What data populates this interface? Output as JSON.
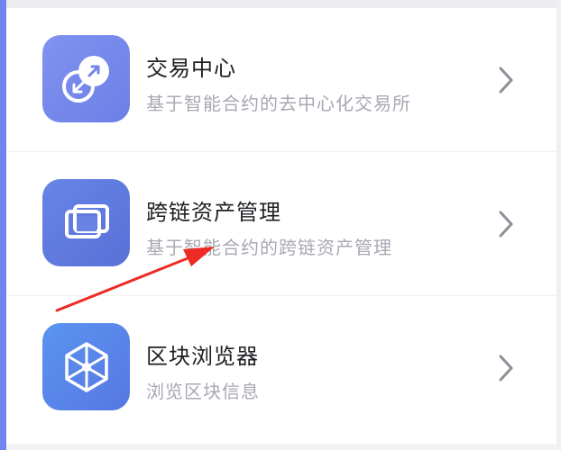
{
  "list": {
    "items": [
      {
        "title": "交易中心",
        "subtitle": "基于智能合约的去中心化交易所",
        "icon": "exchange-icon"
      },
      {
        "title": "跨链资产管理",
        "subtitle": "基于智能合约的跨链资产管理",
        "icon": "cross-chain-icon"
      },
      {
        "title": "区块浏览器",
        "subtitle": "浏览区块信息",
        "icon": "block-explorer-icon"
      }
    ]
  },
  "colors": {
    "accent": "#6f86ee",
    "title": "#1f1f24",
    "subtitle": "#a7a9b2",
    "annotation_arrow": "#ee2a24"
  }
}
